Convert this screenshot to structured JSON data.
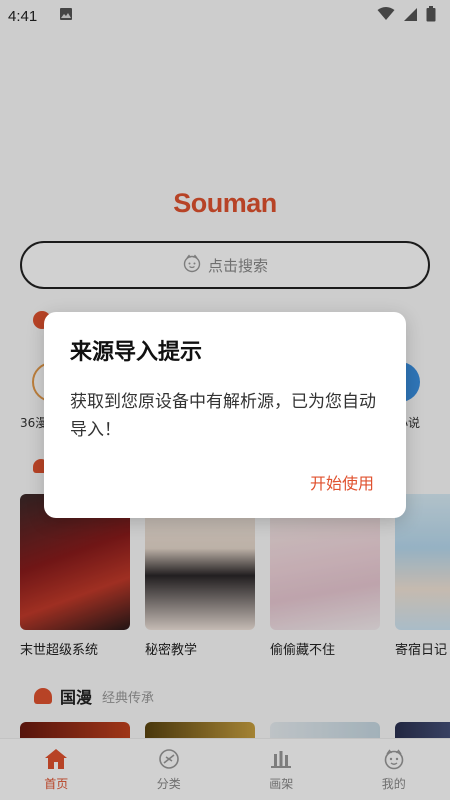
{
  "status_bar": {
    "time": "4:41",
    "icons": [
      "image-icon",
      "wifi-icon",
      "signal-icon",
      "battery-icon"
    ]
  },
  "app": {
    "logo": "Souman",
    "accent_color": "#e0522f"
  },
  "search": {
    "placeholder": "点击搜索",
    "icon": "face-icon"
  },
  "sources": {
    "left_label": "36漫",
    "right_label": "小说"
  },
  "section_featured": {
    "items": [
      {
        "title": "末世超级系统"
      },
      {
        "title": "秘密教学"
      },
      {
        "title": "偷偷藏不住"
      },
      {
        "title": "寄宿日记"
      }
    ]
  },
  "section_domestic": {
    "name": "国漫",
    "subtitle": "经典传承"
  },
  "bottom_nav": {
    "tabs": [
      {
        "label": "首页",
        "icon": "home-icon",
        "active": true
      },
      {
        "label": "分类",
        "icon": "category-icon",
        "active": false
      },
      {
        "label": "画架",
        "icon": "shelf-icon",
        "active": false
      },
      {
        "label": "我的",
        "icon": "profile-icon",
        "active": false
      }
    ]
  },
  "dialog": {
    "title": "来源导入提示",
    "message": "获取到您原设备中有解析源，已为您自动导入！",
    "button": "开始使用"
  }
}
